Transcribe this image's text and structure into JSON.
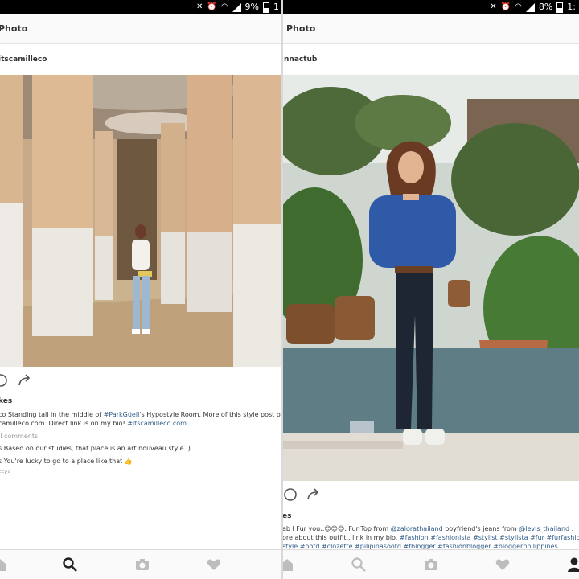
{
  "left": {
    "status": {
      "battery": "9%",
      "extra": "1"
    },
    "title": "Photo",
    "username": "itscamilleco",
    "likes": "kes",
    "caption": {
      "lead": "co Standing tall in the middle of ",
      "tag1": "#ParkGüell",
      "mid": "'s Hypostyle Room. More of this style post on m",
      "line2a": "camilleco.com. Direct link is on my bio! ",
      "tag2": "#itscamilleco.com"
    },
    "comments_link": "ll comments",
    "comments": [
      "s Based on our studies, that place is an art nouveau style :)",
      "s You're lucky to go to a place like that"
    ],
    "emoji": "👍",
    "time": "EEKS"
  },
  "right": {
    "status": {
      "battery": "8%",
      "time": "1:"
    },
    "title": "Photo",
    "username": "nnactub",
    "likes": "es",
    "caption": {
      "l1a": "ab I Fur you..",
      "l1emoji": "😍😍😍",
      "l1b": ". Fur Top from ",
      "tag_zalora": "@zalorathailand",
      "l1c": "  boyfriend's jeans from ",
      "tag_levis": "@levis_thailand",
      "l1d": " .",
      "l2a": "ore about this outfit.. link in my bio. ",
      "l2tags": "#fashion #fashionista #stylist #stylista #fur #furfashio",
      "l3tags": "style #ootd #clozette #pilipinasootd #fblogger #fashionblogger #bloggerphilippines"
    }
  },
  "colors": {
    "hashtag": "#2f5b86",
    "statusbar": "#000000",
    "appbar": "#fafafa"
  },
  "icons": {
    "left_tabs": [
      "home-icon",
      "search-icon",
      "camera-icon",
      "heart-icon"
    ],
    "right_tabs": [
      "home-icon",
      "search-icon",
      "camera-icon",
      "heart-icon",
      "profile-icon"
    ]
  }
}
